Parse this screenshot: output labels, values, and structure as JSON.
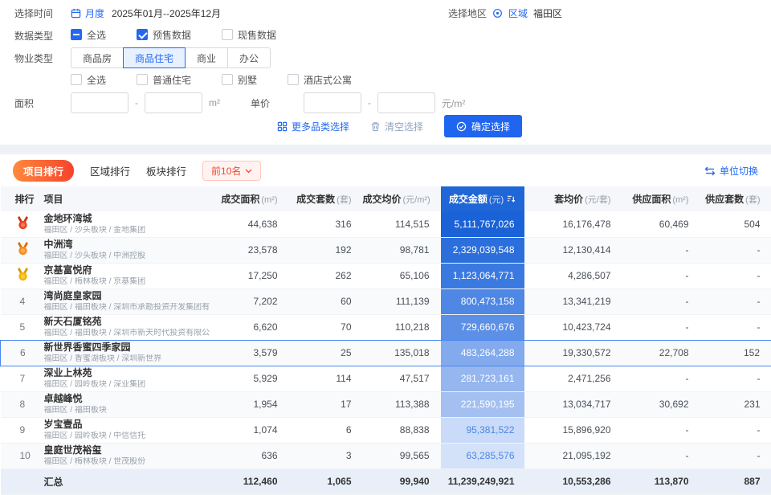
{
  "colors": {
    "primary": "#2468f2",
    "amount_header": "#1f66d6",
    "active_tab_from": "#ff8a3d",
    "active_tab_to": "#f5432c",
    "topn_red": "#f5472f"
  },
  "filter_panel": {
    "time": {
      "label": "选择时间",
      "mode": "月度",
      "range": "2025年01月--2025年12月"
    },
    "region": {
      "label": "选择地区",
      "type": "区域",
      "value": "福田区"
    },
    "data_type": {
      "label": "数据类型",
      "options": [
        {
          "label": "全选",
          "state": "indeterminate"
        },
        {
          "label": "预售数据",
          "state": "checked"
        },
        {
          "label": "现售数据",
          "state": "unchecked"
        }
      ]
    },
    "property_type": {
      "label": "物业类型",
      "tabs": [
        {
          "label": "商品房",
          "active": false
        },
        {
          "label": "商品住宅",
          "active": true
        },
        {
          "label": "商业",
          "active": false
        },
        {
          "label": "办公",
          "active": false
        }
      ],
      "sub_options": [
        {
          "label": "全选",
          "state": "unchecked"
        },
        {
          "label": "普通住宅",
          "state": "unchecked"
        },
        {
          "label": "别墅",
          "state": "unchecked"
        },
        {
          "label": "酒店式公寓",
          "state": "unchecked"
        }
      ]
    },
    "area": {
      "label": "面积",
      "min": "",
      "max": "",
      "unit": "m²"
    },
    "unit_price": {
      "label": "单价",
      "min": "",
      "max": "",
      "unit": "元/m²"
    },
    "actions": {
      "more": "更多品类选择",
      "clear": "清空选择",
      "confirm": "确定选择"
    }
  },
  "ranking": {
    "tabs": [
      {
        "label": "项目排行",
        "active": true
      },
      {
        "label": "区域排行",
        "active": false
      },
      {
        "label": "板块排行",
        "active": false
      }
    ],
    "top_n": "前10名",
    "unit_switch": "单位切换"
  },
  "table": {
    "headers": [
      {
        "label": "排行",
        "unit": "",
        "align": "left"
      },
      {
        "label": "项目",
        "unit": "",
        "align": "left"
      },
      {
        "label": "成交面积",
        "unit": "(m²)",
        "align": "right"
      },
      {
        "label": "成交套数",
        "unit": "(套)",
        "align": "right"
      },
      {
        "label": "成交均价",
        "unit": "(元/m²)",
        "align": "right"
      },
      {
        "label": "成交金额",
        "unit": "(元)",
        "align": "center",
        "highlight": true
      },
      {
        "label": "套均价",
        "unit": "(元/套)",
        "align": "right"
      },
      {
        "label": "供应面积",
        "unit": "(m²)",
        "align": "right"
      },
      {
        "label": "供应套数",
        "unit": "(套)",
        "align": "right"
      }
    ],
    "medal_colors": [
      {
        "body": "#f0421d",
        "ribbon": "#c93012"
      },
      {
        "body": "#fa8c16",
        "ribbon": "#d96c08"
      },
      {
        "body": "#f7b500",
        "ribbon": "#d49a02"
      }
    ],
    "rows": [
      {
        "rank": 1,
        "medal": 1,
        "name": "金地环湾城",
        "sub": "福田区 / 沙头板块 / 金地集团",
        "deal_area": "44,638",
        "deal_units": "316",
        "deal_avg_price": "114,515",
        "deal_amount": "5,111,767,026",
        "amount_bg": "#1a62d8",
        "amount_color": "#ffffff",
        "unit_avg_price": "16,176,478",
        "supply_area": "60,469",
        "supply_units": "504",
        "highlighted": false
      },
      {
        "rank": 2,
        "medal": 2,
        "name": "中洲湾",
        "sub": "福田区 / 沙头板块 / 中洲控股",
        "deal_area": "23,578",
        "deal_units": "192",
        "deal_avg_price": "98,781",
        "deal_amount": "2,329,039,548",
        "amount_bg": "#2b6edc",
        "amount_color": "#ffffff",
        "unit_avg_price": "12,130,414",
        "supply_area": "-",
        "supply_units": "-",
        "highlighted": false
      },
      {
        "rank": 3,
        "medal": 3,
        "name": "京基富悦府",
        "sub": "福田区 / 梅林板块 / 京基集团",
        "deal_area": "17,250",
        "deal_units": "262",
        "deal_avg_price": "65,106",
        "deal_amount": "1,123,064,771",
        "amount_bg": "#3a7ae0",
        "amount_color": "#ffffff",
        "unit_avg_price": "4,286,507",
        "supply_area": "-",
        "supply_units": "-",
        "highlighted": false
      },
      {
        "rank": 4,
        "medal": 0,
        "name": "湾尚庭皇家园",
        "sub": "福田区 / 福田板块 / 深圳市承勘投资开发集团有...",
        "deal_area": "7,202",
        "deal_units": "60",
        "deal_avg_price": "111,139",
        "deal_amount": "800,473,158",
        "amount_bg": "#4e87e4",
        "amount_color": "#ffffff",
        "unit_avg_price": "13,341,219",
        "supply_area": "-",
        "supply_units": "-",
        "highlighted": false
      },
      {
        "rank": 5,
        "medal": 0,
        "name": "新天石厦铭苑",
        "sub": "福田区 / 福田板块 / 深圳市新天时代投资有限公...",
        "deal_area": "6,620",
        "deal_units": "70",
        "deal_avg_price": "110,218",
        "deal_amount": "729,660,676",
        "amount_bg": "#5c90e6",
        "amount_color": "#ffffff",
        "unit_avg_price": "10,423,724",
        "supply_area": "-",
        "supply_units": "-",
        "highlighted": false
      },
      {
        "rank": 6,
        "medal": 0,
        "name": "新世界香蜜四季家园",
        "sub": "福田区 / 香蜜湖板块 / 深圳新世界",
        "deal_area": "3,579",
        "deal_units": "25",
        "deal_avg_price": "135,018",
        "deal_amount": "483,264,288",
        "amount_bg": "#82aaec",
        "amount_color": "#ffffff",
        "unit_avg_price": "19,330,572",
        "supply_area": "22,708",
        "supply_units": "152",
        "highlighted": true
      },
      {
        "rank": 7,
        "medal": 0,
        "name": "深业上林苑",
        "sub": "福田区 / 园岭板块 / 深业集团",
        "deal_area": "5,929",
        "deal_units": "114",
        "deal_avg_price": "47,517",
        "deal_amount": "281,723,161",
        "amount_bg": "#95b6ef",
        "amount_color": "#ffffff",
        "unit_avg_price": "2,471,256",
        "supply_area": "-",
        "supply_units": "-",
        "highlighted": false
      },
      {
        "rank": 8,
        "medal": 0,
        "name": "卓越峰悦",
        "sub": "福田区 / 福田板块",
        "deal_area": "1,954",
        "deal_units": "17",
        "deal_avg_price": "113,388",
        "deal_amount": "221,590,195",
        "amount_bg": "#a4c0f1",
        "amount_color": "#ffffff",
        "unit_avg_price": "13,034,717",
        "supply_area": "30,692",
        "supply_units": "231",
        "highlighted": false
      },
      {
        "rank": 9,
        "medal": 0,
        "name": "岁宝壹品",
        "sub": "福田区 / 园岭板块 / 中信信托",
        "deal_area": "1,074",
        "deal_units": "6",
        "deal_avg_price": "88,838",
        "deal_amount": "95,381,522",
        "amount_bg": "#c9dbf8",
        "amount_color": "#4a86e8",
        "unit_avg_price": "15,896,920",
        "supply_area": "-",
        "supply_units": "-",
        "highlighted": false
      },
      {
        "rank": 10,
        "medal": 0,
        "name": "皇庭世茂裕玺",
        "sub": "福田区 / 梅林板块 / 世茂股份",
        "deal_area": "636",
        "deal_units": "3",
        "deal_avg_price": "99,565",
        "deal_amount": "63,285,576",
        "amount_bg": "#d4e2f9",
        "amount_color": "#4a86e8",
        "unit_avg_price": "21,095,192",
        "supply_area": "-",
        "supply_units": "-",
        "highlighted": false
      }
    ],
    "total": {
      "label": "汇总",
      "deal_area": "112,460",
      "deal_units": "1,065",
      "deal_avg_price": "99,940",
      "deal_amount": "11,239,249,921",
      "unit_avg_price": "10,553,286",
      "supply_area": "113,870",
      "supply_units": "887"
    }
  }
}
